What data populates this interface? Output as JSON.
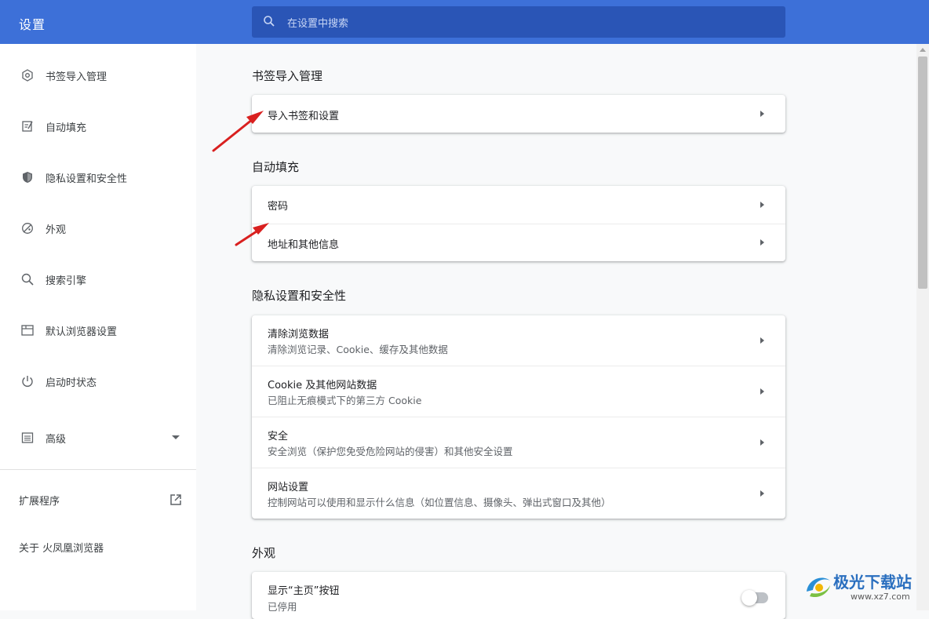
{
  "header": {
    "title": "设置",
    "search_placeholder": "在设置中搜索",
    "accent": "#3d70d8"
  },
  "sidebar": {
    "items": [
      {
        "label": "书签导入管理",
        "icon": "gear-outline-icon"
      },
      {
        "label": "自动填充",
        "icon": "edit-note-icon"
      },
      {
        "label": "隐私设置和安全性",
        "icon": "shield-icon"
      },
      {
        "label": "外观",
        "icon": "palette-icon"
      },
      {
        "label": "搜索引擎",
        "icon": "search-icon"
      },
      {
        "label": "默认浏览器设置",
        "icon": "browser-window-icon"
      },
      {
        "label": "启动时状态",
        "icon": "power-icon"
      },
      {
        "label": "高级",
        "icon": "list-icon"
      }
    ],
    "extensions": "扩展程序",
    "about": "关于 火凤凰浏览器"
  },
  "sections": {
    "bookmarks": {
      "title": "书签导入管理",
      "rows": [
        {
          "title": "导入书签和设置"
        }
      ]
    },
    "autofill": {
      "title": "自动填充",
      "rows": [
        {
          "title": "密码"
        },
        {
          "title": "地址和其他信息"
        }
      ]
    },
    "privacy": {
      "title": "隐私设置和安全性",
      "rows": [
        {
          "title": "清除浏览数据",
          "sub": "清除浏览记录、Cookie、缓存及其他数据"
        },
        {
          "title": "Cookie 及其他网站数据",
          "sub": "已阻止无痕模式下的第三方 Cookie"
        },
        {
          "title": "安全",
          "sub": "安全浏览（保护您免受危险网站的侵害）和其他安全设置"
        },
        {
          "title": "网站设置",
          "sub": "控制网站可以使用和显示什么信息（如位置信息、摄像头、弹出式窗口及其他）"
        }
      ]
    },
    "appearance": {
      "title": "外观",
      "rows": [
        {
          "title": "显示“主页”按钮",
          "sub": "已停用",
          "toggle": false
        }
      ]
    }
  },
  "watermark": {
    "text": "极光下载站",
    "url": "www.xz7.com"
  }
}
